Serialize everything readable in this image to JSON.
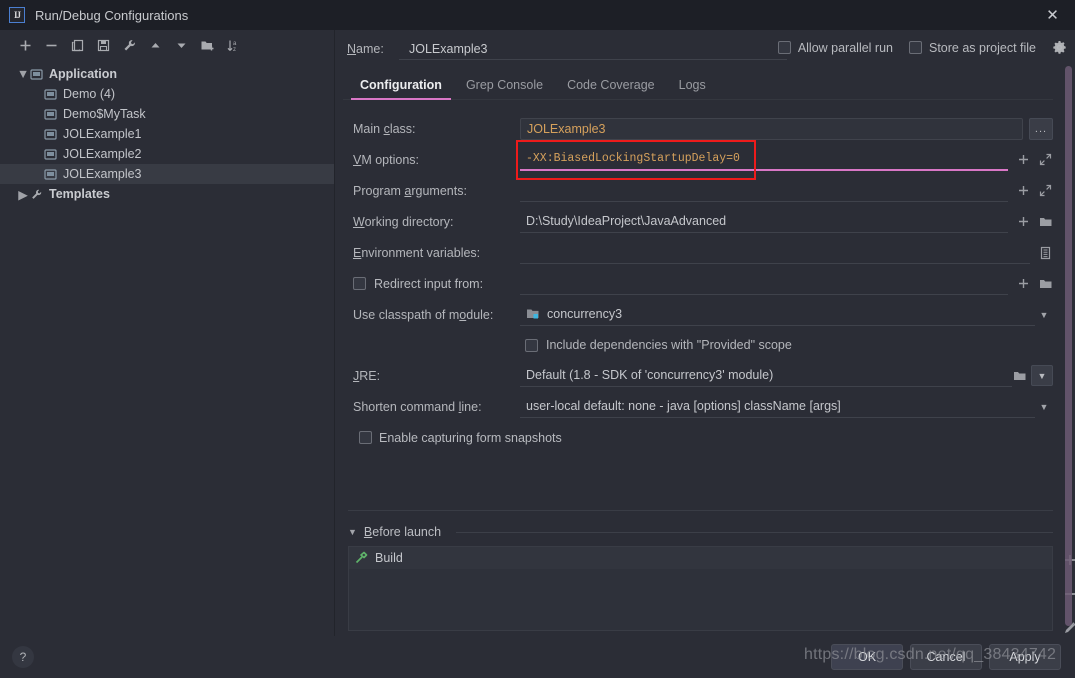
{
  "window": {
    "title": "Run/Debug Configurations",
    "logo_text": "IJ",
    "close_label": "✕"
  },
  "left": {
    "toolbar": [
      {
        "name": "add-configuration-button",
        "label": "+"
      },
      {
        "name": "remove-configuration-button",
        "label": "−"
      },
      {
        "name": "copy-configuration-button",
        "label": "Copy"
      },
      {
        "name": "save-configuration-button",
        "label": "Save"
      },
      {
        "name": "edit-templates-button",
        "label": "Edit Templates"
      },
      {
        "name": "move-up-button",
        "label": "Move Up"
      },
      {
        "name": "move-down-button",
        "label": "Move Down"
      },
      {
        "name": "new-folder-button",
        "label": "New Folder"
      },
      {
        "name": "sort-configurations-button",
        "label": "Sort"
      }
    ],
    "tree": [
      {
        "label": "Application",
        "type": "group",
        "expanded": true,
        "twisty": "▼"
      },
      {
        "label": "Demo (4)",
        "type": "child"
      },
      {
        "label": "Demo$MyTask",
        "type": "child"
      },
      {
        "label": "JOLExample1",
        "type": "child"
      },
      {
        "label": "JOLExample2",
        "type": "child"
      },
      {
        "label": "JOLExample3",
        "type": "child",
        "selected": true
      },
      {
        "label": "Templates",
        "type": "group",
        "expanded": false,
        "twisty": "▶"
      }
    ]
  },
  "right": {
    "name_label": "Name:",
    "name_label_mnemonic": "N",
    "name_value": "JOLExample3",
    "allow_parallel_run": {
      "label": "Allow parallel run",
      "checked": false
    },
    "store_as_project_file": {
      "label": "Store as project file",
      "checked": false
    },
    "gear_icon": "gear-icon",
    "tabs": [
      {
        "label": "Configuration",
        "active": true
      },
      {
        "label": "Grep Console",
        "active": false
      },
      {
        "label": "Code Coverage",
        "active": false
      },
      {
        "label": "Logs",
        "active": false
      }
    ],
    "tab_accent_color": "#d977c6",
    "fields": {
      "main_class_label": "Main class:",
      "main_class_value": "JOLExample3",
      "main_class_browse": "...",
      "vm_options_label": "VM options:",
      "vm_options_value": "-XX:BiasedLockingStartupDelay=0",
      "program_arguments_label": "Program arguments:",
      "program_arguments_value": "",
      "working_directory_label": "Working directory:",
      "working_directory_value": "D:\\Study\\IdeaProject\\JavaAdvanced",
      "environment_variables_label": "Environment variables:",
      "environment_variables_value": "",
      "redirect_input_label": "Redirect input from:",
      "redirect_input_checked": false,
      "redirect_input_value": "",
      "use_classpath_label": "Use classpath of module:",
      "use_classpath_value": "concurrency3",
      "include_provided_label": "Include dependencies with \"Provided\" scope",
      "include_provided_checked": false,
      "jre_label": "JRE:",
      "jre_value": "Default (1.8 - SDK of 'concurrency3' module)",
      "shorten_cmd_label": "Shorten command line:",
      "shorten_cmd_value": "user-local default: none - java [options] className [args]",
      "capture_snapshots_label": "Enable capturing form snapshots",
      "capture_snapshots_checked": false
    },
    "before_launch": {
      "title": "Before launch",
      "twisty": "▼",
      "items": [
        {
          "label": "Build",
          "icon": "build-hammer-icon"
        }
      ],
      "side_buttons": [
        {
          "name": "add-before-launch-task-button",
          "label": "+"
        },
        {
          "name": "remove-before-launch-task-button",
          "label": "−"
        },
        {
          "name": "edit-before-launch-task-button",
          "label": "Edit"
        }
      ]
    }
  },
  "footer": {
    "help_label": "?",
    "buttons": [
      {
        "label": "OK",
        "primary": true,
        "name": "ok-button"
      },
      {
        "label": "Cancel",
        "primary": false,
        "name": "cancel-button"
      },
      {
        "label": "Apply",
        "primary": false,
        "name": "apply-button"
      }
    ]
  },
  "watermark": {
    "text": "https://blog.csdn.net/qq_38434742"
  },
  "annotation": {
    "color": "#ee1b1b",
    "target": "vm-options-input"
  }
}
